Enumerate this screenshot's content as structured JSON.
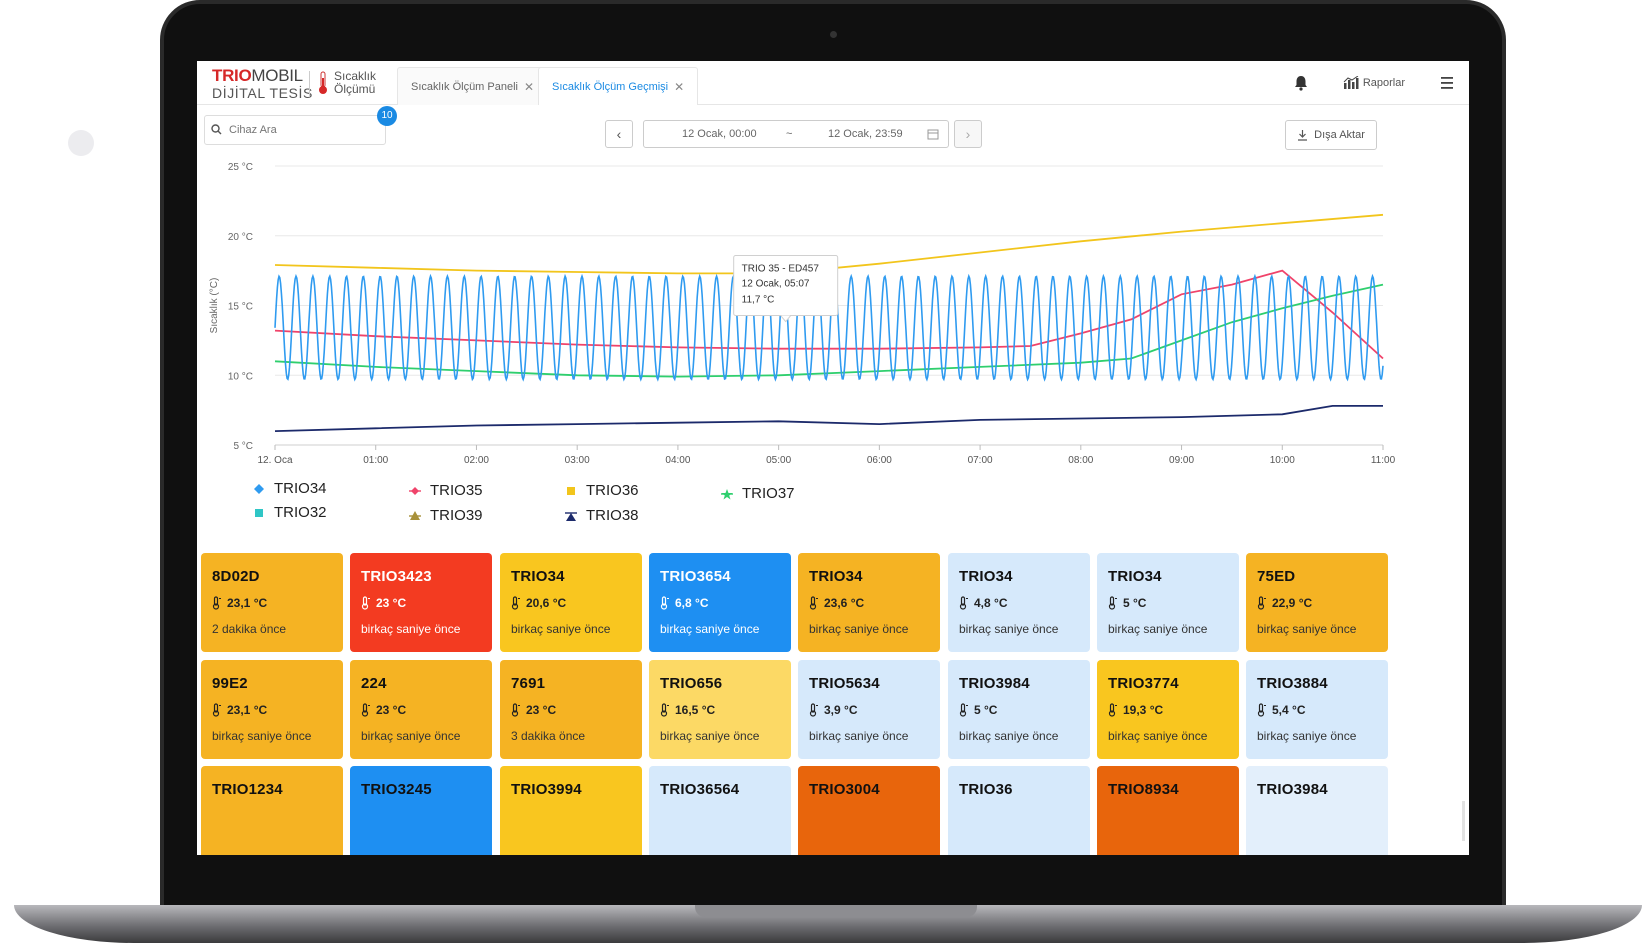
{
  "brand": {
    "logo_bold": "TRIO",
    "logo_light": "MOBIL",
    "logo_sub": "DİJİTAL TESİS",
    "app_line1": "Sıcaklık",
    "app_line2": "Ölçümü"
  },
  "tabs": [
    {
      "label": "Sıcaklık Ölçüm Paneli",
      "active": false
    },
    {
      "label": "Sıcaklık Ölçüm Geçmişi",
      "active": true
    }
  ],
  "header": {
    "reports_label": "Raporlar"
  },
  "search": {
    "placeholder": "Cihaz Ara",
    "badge": "10"
  },
  "date_range": {
    "start": "12 Ocak, 00:00",
    "separator": "~",
    "end": "12 Ocak, 23:59"
  },
  "export_label": "Dışa Aktar",
  "colors": {
    "TRIO34": "#2f9bf0",
    "TRIO35": "#f0436a",
    "TRIO36": "#f2c51c",
    "TRIO37": "#2fcf6e",
    "TRIO38": "#1c2a6b",
    "TRIO32": "#2fc6c6",
    "TRIO39": "#a8913a"
  },
  "chart_data": {
    "type": "line",
    "ylabel": "Sıcaklık (°C)",
    "y_ticks": [
      "25 °C",
      "20 °C",
      "15 °C",
      "10 °C",
      "5 °C"
    ],
    "ylim": [
      5,
      25
    ],
    "x_ticks": [
      "12. Oca",
      "01:00",
      "02:00",
      "03:00",
      "04:00",
      "05:00",
      "06:00",
      "07:00",
      "08:00",
      "09:00",
      "10:00",
      "11:00"
    ],
    "xlim": [
      0,
      11
    ],
    "grid": true,
    "legend": [
      "TRIO34",
      "TRIO35",
      "TRIO36",
      "TRIO37",
      "TRIO32",
      "TRIO39",
      "TRIO38"
    ],
    "series": [
      {
        "name": "TRIO36",
        "x": [
          0,
          1,
          2,
          3,
          4,
          5,
          6,
          7,
          8,
          9,
          10,
          11
        ],
        "values": [
          17.9,
          17.7,
          17.5,
          17.4,
          17.3,
          17.3,
          18.0,
          18.8,
          19.6,
          20.3,
          20.9,
          21.5
        ]
      },
      {
        "name": "TRIO35",
        "x": [
          0,
          1,
          2,
          3,
          4,
          5,
          6,
          7,
          7.5,
          8,
          8.5,
          9,
          9.5,
          10,
          10.5,
          11
        ],
        "values": [
          13.2,
          12.8,
          12.5,
          12.2,
          12.0,
          11.9,
          11.9,
          12.0,
          12.1,
          13.0,
          14.0,
          15.8,
          16.5,
          17.5,
          14.5,
          11.2
        ]
      },
      {
        "name": "TRIO37",
        "x": [
          0,
          1,
          2,
          3,
          4,
          5,
          6,
          7,
          8,
          8.5,
          9,
          9.5,
          10,
          10.5,
          11
        ],
        "values": [
          11.0,
          10.6,
          10.3,
          10.0,
          9.9,
          10.0,
          10.3,
          10.6,
          10.9,
          11.2,
          12.5,
          13.8,
          14.8,
          15.7,
          16.5
        ]
      },
      {
        "name": "TRIO38",
        "x": [
          0,
          1,
          2,
          3,
          4,
          5,
          6,
          7,
          8,
          9,
          10,
          10.5,
          11
        ],
        "values": [
          6.0,
          6.2,
          6.4,
          6.5,
          6.6,
          6.7,
          6.5,
          6.8,
          6.9,
          7.0,
          7.2,
          7.8,
          7.8
        ]
      },
      {
        "name": "TRIO34",
        "oscillating": true,
        "period_h": 0.167,
        "low": 9.7,
        "high": 17.1,
        "x_range": [
          0,
          11
        ]
      }
    ],
    "tooltip": {
      "title": "TRIO 35 -  ED457",
      "time": "12 Ocak, 05:07",
      "value": "11,7 °C"
    }
  },
  "cards": [
    {
      "name": "8D02D",
      "temp": "23,1 °C",
      "time": "2 dakika önce",
      "color": "#f5b323",
      "dark": false
    },
    {
      "name": "TRIO3423",
      "temp": "23 °C",
      "time": "birkaç saniye önce",
      "color": "#f33b21",
      "dark": true
    },
    {
      "name": "TRIO34",
      "temp": "20,6 °C",
      "time": "birkaç saniye önce",
      "color": "#f9c61f",
      "dark": false
    },
    {
      "name": "TRIO3654",
      "temp": "6,8 °C",
      "time": "birkaç saniye önce",
      "color": "#1e8ff2",
      "dark": true
    },
    {
      "name": "TRIO34",
      "temp": "23,6 °C",
      "time": "birkaç saniye önce",
      "color": "#f5b323",
      "dark": false
    },
    {
      "name": "TRIO34",
      "temp": "4,8 °C",
      "time": "birkaç saniye önce",
      "color": "#d6e9fb",
      "dark": false
    },
    {
      "name": "TRIO34",
      "temp": "5 °C",
      "time": "birkaç saniye önce",
      "color": "#d6e9fb",
      "dark": false
    },
    {
      "name": "75ED",
      "temp": "22,9 °C",
      "time": "birkaç saniye önce",
      "color": "#f5b323",
      "dark": false
    },
    {
      "name": "99E2",
      "temp": "23,1 °C",
      "time": "birkaç saniye önce",
      "color": "#f5b323",
      "dark": false
    },
    {
      "name": "224",
      "temp": "23 °C",
      "time": "birkaç saniye önce",
      "color": "#f5b323",
      "dark": false
    },
    {
      "name": "7691",
      "temp": "23 °C",
      "time": "3 dakika önce",
      "color": "#f5b323",
      "dark": false
    },
    {
      "name": "TRIO656",
      "temp": "16,5 °C",
      "time": "birkaç saniye önce",
      "color": "#fcd965",
      "dark": false
    },
    {
      "name": "TRIO5634",
      "temp": "3,9 °C",
      "time": "birkaç saniye önce",
      "color": "#d6e9fb",
      "dark": false
    },
    {
      "name": "TRIO3984",
      "temp": "5 °C",
      "time": "birkaç saniye önce",
      "color": "#d6e9fb",
      "dark": false
    },
    {
      "name": "TRIO3774",
      "temp": "19,3 °C",
      "time": "birkaç saniye önce",
      "color": "#f9c61f",
      "dark": false
    },
    {
      "name": "TRIO3884",
      "temp": "5,4 °C",
      "time": "birkaç saniye önce",
      "color": "#d6e9fb",
      "dark": false
    },
    {
      "name": "TRIO1234",
      "temp": "",
      "time": "",
      "color": "#f5b323",
      "dark": false
    },
    {
      "name": "TRIO3245",
      "temp": "",
      "time": "",
      "color": "#1e8ff2",
      "dark": false
    },
    {
      "name": "TRIO3994",
      "temp": "",
      "time": "",
      "color": "#f9c61f",
      "dark": false
    },
    {
      "name": "TRIO36564",
      "temp": "",
      "time": "",
      "color": "#d6e9fb",
      "dark": false
    },
    {
      "name": "TRIO3004",
      "temp": "",
      "time": "",
      "color": "#e8650c",
      "dark": false
    },
    {
      "name": "TRIO36",
      "temp": "",
      "time": "",
      "color": "#d6e9fb",
      "dark": false
    },
    {
      "name": "TRIO8934",
      "temp": "",
      "time": "",
      "color": "#e8650c",
      "dark": false
    },
    {
      "name": "TRIO3984",
      "temp": "",
      "time": "",
      "color": "#e3effb",
      "dark": false
    }
  ]
}
